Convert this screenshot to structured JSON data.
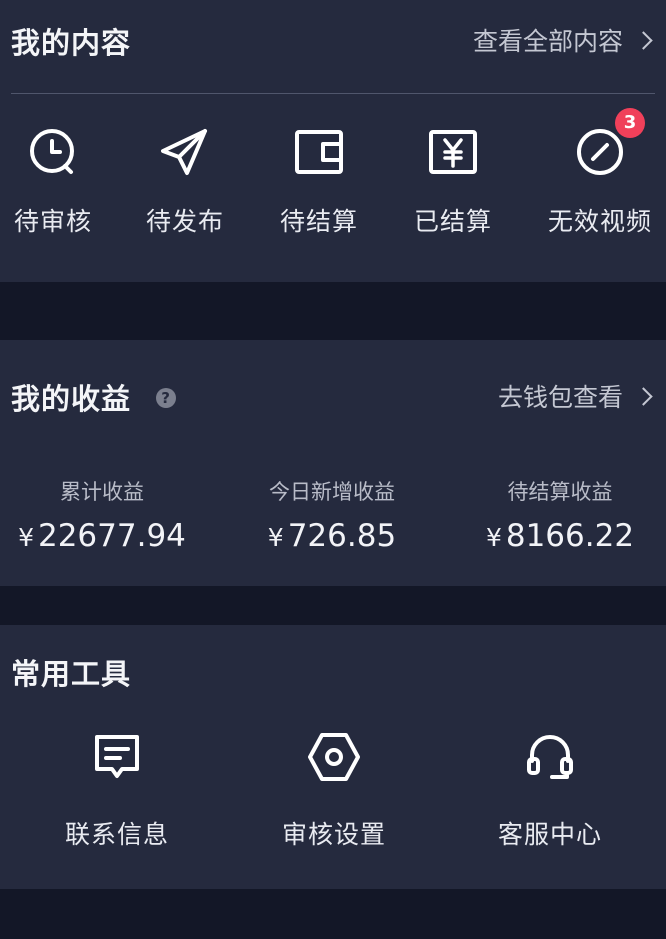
{
  "content": {
    "title": "我的内容",
    "link": "查看全部内容",
    "items": [
      {
        "label": "待审核",
        "icon": "clock-icon"
      },
      {
        "label": "待发布",
        "icon": "paper-plane-icon"
      },
      {
        "label": "待结算",
        "icon": "wallet-icon"
      },
      {
        "label": "已结算",
        "icon": "yen-ticket-icon"
      },
      {
        "label": "无效视频",
        "icon": "invalid-circle-icon",
        "badge": "3"
      }
    ]
  },
  "earnings": {
    "title": "我的收益",
    "link": "去钱包查看",
    "currency": "¥",
    "stats": [
      {
        "label": "累计收益",
        "value": "22677.94"
      },
      {
        "label": "今日新增收益",
        "value": "726.85"
      },
      {
        "label": "待结算收益",
        "value": "8166.22"
      }
    ]
  },
  "tools": {
    "title": "常用工具",
    "items": [
      {
        "label": "联系信息",
        "icon": "message-icon"
      },
      {
        "label": "审核设置",
        "icon": "hex-settings-icon"
      },
      {
        "label": "客服中心",
        "icon": "headset-icon"
      }
    ]
  },
  "colors": {
    "panel": "#252a3e",
    "background": "#141828",
    "badge": "#f0405a",
    "text": "#f4f5f8"
  }
}
